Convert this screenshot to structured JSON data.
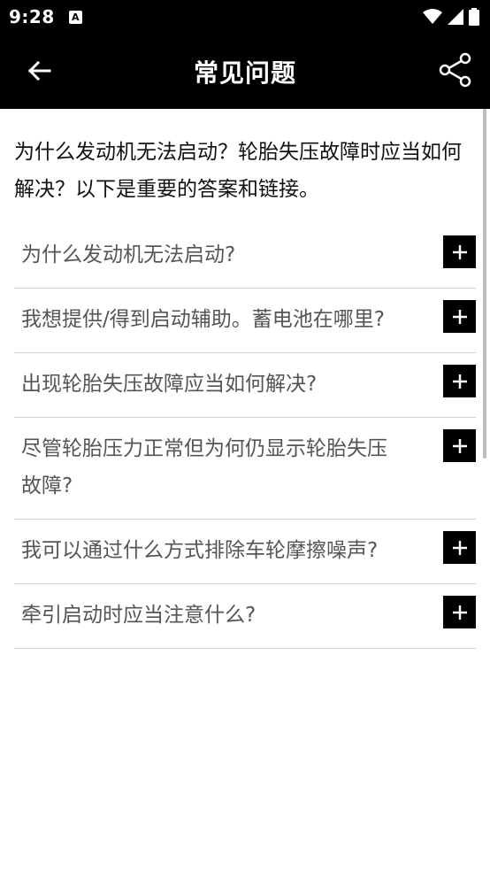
{
  "status_bar": {
    "time": "9:28",
    "notification_glyph": "A",
    "icons": [
      "wifi-icon",
      "signal-icon",
      "battery-icon"
    ]
  },
  "app_bar": {
    "title": "常见问题",
    "back_icon": "arrow-left-icon",
    "share_icon": "share-icon"
  },
  "intro": "为什么发动机无法启动？轮胎失压故障时应当如何解决？以下是重要的答案和链接。",
  "faq": [
    {
      "question": "为什么发动机无法启动?"
    },
    {
      "question": "我想提供/得到启动辅助。蓄电池在哪里?"
    },
    {
      "question": "出现轮胎失压故障应当如何解决?"
    },
    {
      "question": "尽管轮胎压力正常但为何仍显示轮胎失压故障?"
    },
    {
      "question": "我可以通过什么方式排除车轮摩擦噪声?"
    },
    {
      "question": "牵引启动时应当注意什么?"
    }
  ],
  "colors": {
    "bar_background": "#000000",
    "question_text": "#555555",
    "divider": "#cfcfcf"
  }
}
